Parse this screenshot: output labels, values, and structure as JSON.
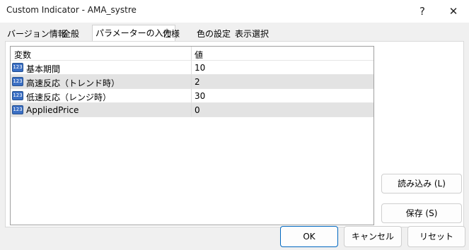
{
  "window": {
    "title": "Custom Indicator - AMA_systre",
    "help_label": "?",
    "close_label": "✕"
  },
  "tabs": [
    {
      "label": "バージョン情報"
    },
    {
      "label": "全般"
    },
    {
      "label": "パラメーターの入力"
    },
    {
      "label": "仕様"
    },
    {
      "label": "色の設定"
    },
    {
      "label": "表示選択"
    }
  ],
  "active_tab_index": 2,
  "grid": {
    "headers": {
      "variable": "変数",
      "value": "値"
    },
    "rows": [
      {
        "icon": "numeric-123-icon",
        "icon_text": "123",
        "name": "基本期間",
        "value": "10"
      },
      {
        "icon": "numeric-123-icon",
        "icon_text": "123",
        "name": "高速反応（トレンド時）",
        "value": "2"
      },
      {
        "icon": "numeric-123-icon",
        "icon_text": "123",
        "name": "低速反応（レンジ時）",
        "value": "30"
      },
      {
        "icon": "numeric-123-icon",
        "icon_text": "123",
        "name": "AppliedPrice",
        "value": "0"
      }
    ]
  },
  "side_buttons": {
    "load": "読み込み (L)",
    "save": "保存 (S)"
  },
  "footer_buttons": {
    "ok": "OK",
    "cancel": "キャンセル",
    "reset": "リセット"
  },
  "colors": {
    "accent": "#0067c0",
    "row_highlight": "#e3e3e3",
    "icon_blue": "#3b6fc4"
  }
}
